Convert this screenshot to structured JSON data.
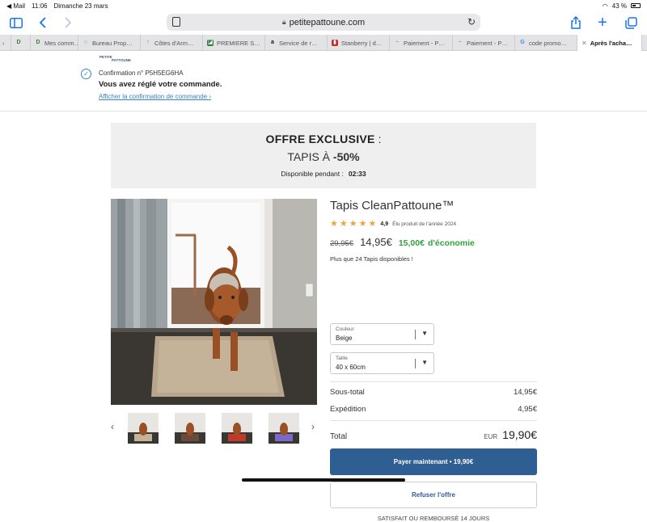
{
  "status_bar": {
    "back_app": "◀ Mail",
    "time": "11:06",
    "date": "Dimanche 23 mars",
    "battery": "43 %"
  },
  "browser": {
    "url": "petitepattoune.com",
    "tabs": [
      {
        "label": "D",
        "fav": "D",
        "fav_color": "#3a7d2c"
      },
      {
        "label": "Mes comm…",
        "fav": "D",
        "fav_color": "#3a7d2c"
      },
      {
        "label": "Bureau Prop…",
        "fav": "○",
        "fav_color": "#1aa3c9"
      },
      {
        "label": "Côtes d'Arm…",
        "fav": "↑",
        "fav_color": "#5a8c3a"
      },
      {
        "label": "PREMIERE S…",
        "fav": "◪",
        "fav_color": "#2d7a3c"
      },
      {
        "label": "Service de r…",
        "fav": "a",
        "fav_color": "#111111"
      },
      {
        "label": "Stanberry | d…",
        "fav": "▮",
        "fav_color": "#c62828"
      },
      {
        "label": "Paiement - P…",
        "fav": "~",
        "fav_color": "#6aa0d8"
      },
      {
        "label": "Paiement - P…",
        "fav": "~",
        "fav_color": "#6aa0d8"
      },
      {
        "label": "code promo…",
        "fav": "G",
        "fav_color": "#4285f4"
      },
      {
        "label": "Après l'acha…",
        "fav": "✕",
        "fav_color": "#666666"
      }
    ]
  },
  "confirmation": {
    "logo_text": "PETITE PATTOUNE",
    "number": "Confirmation n° P5H5EG6HA",
    "title": "Vous avez réglé votre commande.",
    "link": "Afficher la confirmation de commande ›"
  },
  "offer": {
    "title_bold": "OFFRE EXCLUSIVE",
    "title_rest": " :",
    "sub_prefix": "TAPIS À ",
    "sub_bold": "-50%",
    "timer_label": "Disponible pendant :",
    "timer_value": "02:33"
  },
  "product": {
    "title": "Tapis CleanPattoune™",
    "rating_value": "4,9",
    "stars": 5,
    "rating_text": "Élu produit de l'année 2024",
    "old_price": "29,95€",
    "new_price": "14,95€",
    "saving_amount": "15,00€",
    "saving_label": "d'économie",
    "stock": "Plus que 24 Tapis disponibles !",
    "color_label": "Couleur",
    "color_value": "Beige",
    "size_label": "Taille",
    "size_value": "40 x 60cm"
  },
  "summary": {
    "subtotal_label": "Sous-total",
    "subtotal_value": "14,95€",
    "shipping_label": "Expédition",
    "shipping_value": "4,95€",
    "total_label": "Total",
    "total_currency": "EUR",
    "total_value": "19,90€"
  },
  "actions": {
    "pay": "Payer maintenant • 19,90€",
    "refuse": "Refuser l'offre",
    "guarantee": "SATISFAIT OU REMBOURSÉ 14 JOURS"
  },
  "colors": {
    "accent": "#2e5e92",
    "saving": "#2fa53c",
    "star": "#f0a33c",
    "link": "#3b82c4"
  }
}
